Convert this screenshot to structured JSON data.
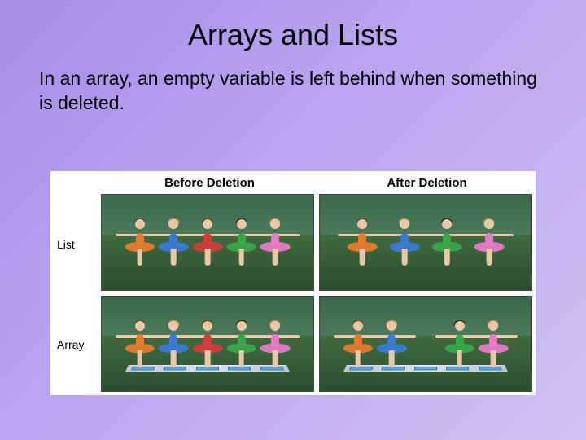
{
  "title": "Arrays and Lists",
  "body_text": "In an array, an empty variable is left behind when something is deleted.",
  "figure": {
    "columns": {
      "before": "Before Deletion",
      "after": "After Deletion"
    },
    "rows": {
      "list": "List",
      "array": "Array"
    },
    "dancer_colors_full": [
      "orange",
      "blue",
      "red",
      "green",
      "pink"
    ],
    "cells": {
      "list_before": {
        "has_mat": false,
        "slots": [
          "orange",
          "blue",
          "red",
          "green",
          "pink"
        ]
      },
      "list_after": {
        "has_mat": false,
        "slots": [
          "orange",
          "blue",
          "green",
          "pink"
        ]
      },
      "array_before": {
        "has_mat": true,
        "slots": [
          "orange",
          "blue",
          "red",
          "green",
          "pink"
        ]
      },
      "array_after": {
        "has_mat": true,
        "slots": [
          "orange",
          "blue",
          null,
          "green",
          "pink"
        ]
      }
    }
  }
}
